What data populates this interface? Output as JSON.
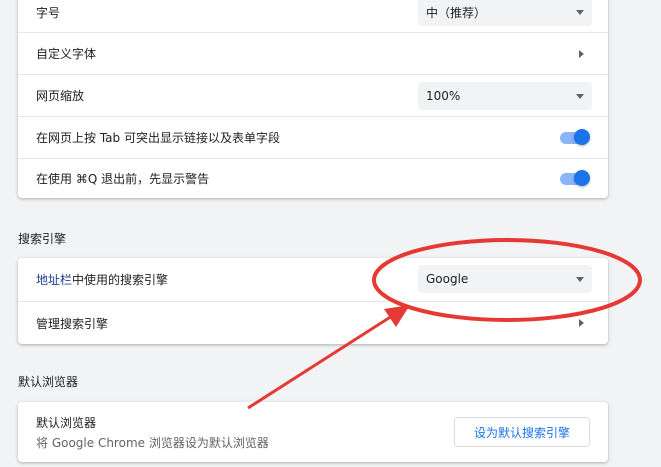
{
  "appearance": {
    "font_size_label": "字号",
    "font_size_value": "中（推荐）",
    "custom_fonts_label": "自定义字体",
    "page_zoom_label": "网页缩放",
    "page_zoom_value": "100%",
    "tab_highlight_label": "在网页上按 Tab 可突出显示链接以及表单字段",
    "tab_highlight_enabled": true,
    "quit_warning_label": "在使用 ⌘Q 退出前，先显示警告",
    "quit_warning_enabled": true
  },
  "search_engine": {
    "section_title": "搜索引擎",
    "address_bar_link": "地址栏",
    "address_bar_label_rest": "中使用的搜索引擎",
    "selected_engine": "Google",
    "manage_label": "管理搜索引擎"
  },
  "default_browser": {
    "section_title": "默认浏览器",
    "label": "默认浏览器",
    "description": "将 Google Chrome 浏览器设为默认浏览器",
    "button_label": "设为默认搜索引擎"
  },
  "annotation": {
    "color": "#e53935"
  }
}
